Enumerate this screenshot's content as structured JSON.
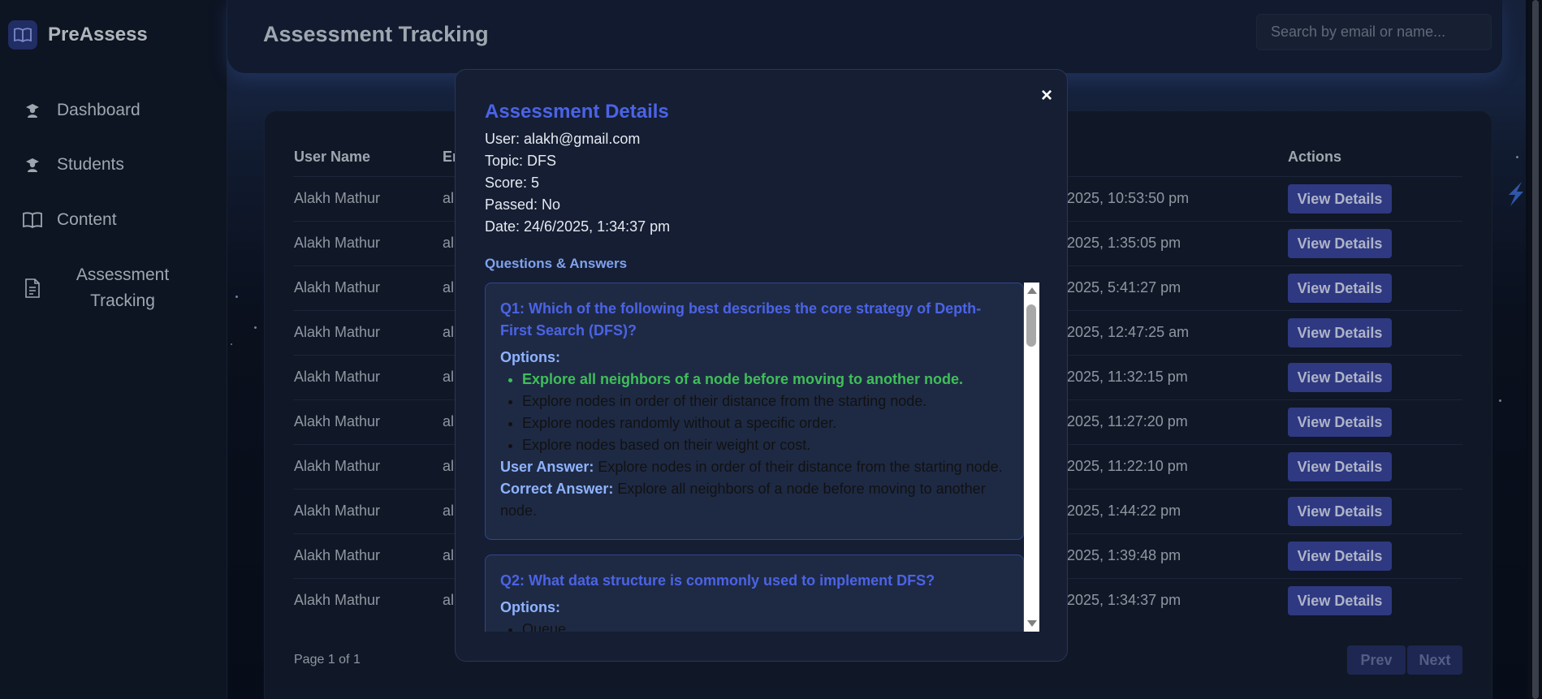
{
  "brand": {
    "name": "PreAssess"
  },
  "sidebar": {
    "items": [
      {
        "label": "Dashboard",
        "icon": "graduate-icon"
      },
      {
        "label": "Students",
        "icon": "graduate-icon"
      },
      {
        "label": "Content",
        "icon": "book-icon"
      },
      {
        "label": "Assessment Tracking",
        "icon": "document-icon"
      }
    ]
  },
  "header": {
    "title": "Assessment Tracking",
    "search_placeholder": "Search by email or name..."
  },
  "table": {
    "columns": [
      "User Name",
      "Em",
      "Actions"
    ],
    "rows": [
      {
        "name": "Alakh Mathur",
        "email": "al",
        "date": "2025, 10:53:50 pm",
        "action": "View Details"
      },
      {
        "name": "Alakh Mathur",
        "email": "al",
        "date": "2025, 1:35:05 pm",
        "action": "View Details"
      },
      {
        "name": "Alakh Mathur",
        "email": "al",
        "date": "2025, 5:41:27 pm",
        "action": "View Details"
      },
      {
        "name": "Alakh Mathur",
        "email": "al",
        "date": "2025, 12:47:25 am",
        "action": "View Details"
      },
      {
        "name": "Alakh Mathur",
        "email": "al",
        "date": "2025, 11:32:15 pm",
        "action": "View Details"
      },
      {
        "name": "Alakh Mathur",
        "email": "al",
        "date": "2025, 11:27:20 pm",
        "action": "View Details"
      },
      {
        "name": "Alakh Mathur",
        "email": "al",
        "date": "2025, 11:22:10 pm",
        "action": "View Details"
      },
      {
        "name": "Alakh Mathur",
        "email": "al",
        "date": "2025, 1:44:22 pm",
        "action": "View Details"
      },
      {
        "name": "Alakh Mathur",
        "email": "al",
        "date": "2025, 1:39:48 pm",
        "action": "View Details"
      },
      {
        "name": "Alakh Mathur",
        "email": "al",
        "date": "2025, 1:34:37 pm",
        "action": "View Details"
      }
    ]
  },
  "pagination": {
    "info": "Page 1 of 1",
    "prev": "Prev",
    "next": "Next"
  },
  "modal": {
    "title": "Assessment Details",
    "close": "×",
    "user": "User: alakh@gmail.com",
    "topic": "Topic: DFS",
    "score": "Score: 5",
    "passed": "Passed: No",
    "date": "Date: 24/6/2025, 1:34:37 pm",
    "qa_heading": "Questions & Answers",
    "questions": [
      {
        "question": "Q1: Which of the following best describes the core strategy of Depth-First Search (DFS)?",
        "options_label": "Options:",
        "options": [
          "Explore all neighbors of a node before moving to another node.",
          "Explore nodes in order of their distance from the starting node.",
          "Explore nodes randomly without a specific order.",
          "Explore nodes based on their weight or cost."
        ],
        "user_answer_label": "User Answer:",
        "user_answer": "Explore nodes in order of their distance from the starting node.",
        "correct_answer_label": "Correct Answer:",
        "correct_answer": "Explore all neighbors of a node before moving to another node."
      },
      {
        "question": "Q2: What data structure is commonly used to implement DFS?",
        "options_label": "Options:",
        "options": [
          "Queue"
        ]
      }
    ]
  },
  "colors": {
    "accent": "#4b63e6",
    "correct": "#3fbf58",
    "button": "#3b4aa6"
  }
}
